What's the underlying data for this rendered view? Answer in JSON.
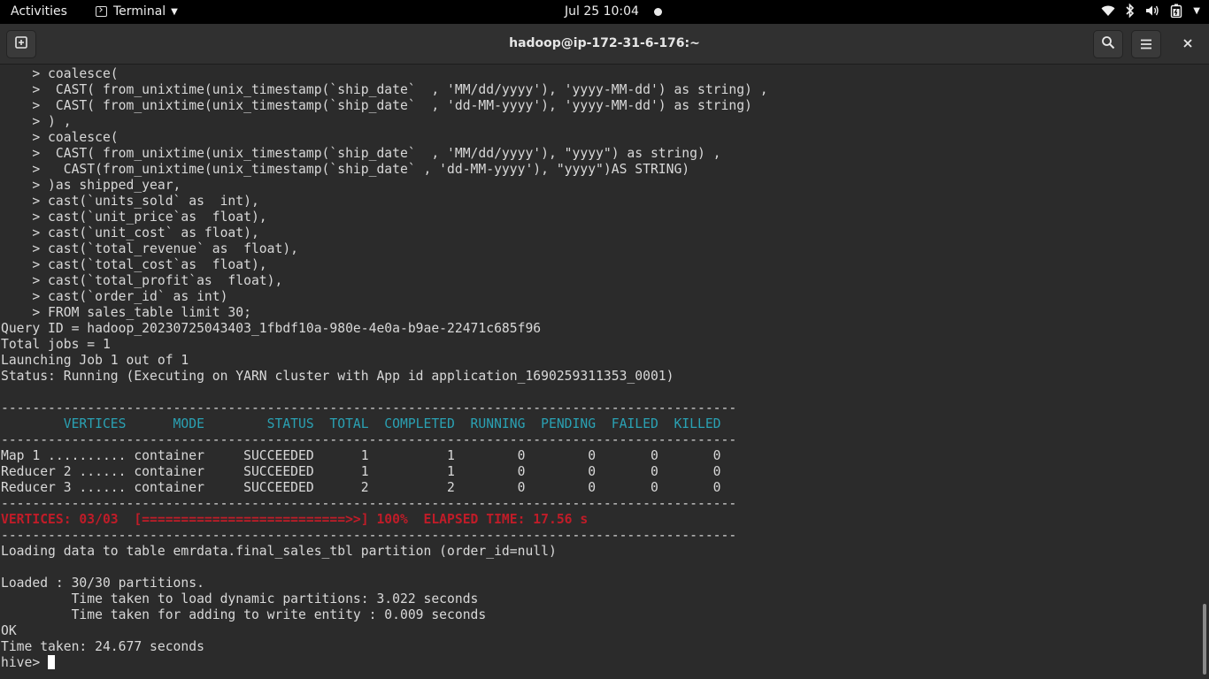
{
  "topbar": {
    "activities": "Activities",
    "app_name": "Terminal",
    "clock": "Jul 25  10:04",
    "icons": [
      "terminal-icon",
      "wifi-icon",
      "bluetooth-icon",
      "volume-icon",
      "battery-icon",
      "chevron-down-icon"
    ]
  },
  "window": {
    "title": "hadoop@ip-172-31-6-176:~",
    "icons": [
      "new-tab-icon",
      "search-icon",
      "hamburger-menu-icon",
      "close-icon"
    ]
  },
  "terminal": {
    "lines": [
      "    > coalesce(",
      "    >  CAST( from_unixtime(unix_timestamp(`ship_date`  , 'MM/dd/yyyy'), 'yyyy-MM-dd') as string) ,",
      "    >  CAST( from_unixtime(unix_timestamp(`ship_date`  , 'dd-MM-yyyy'), 'yyyy-MM-dd') as string)",
      "    > ) ,",
      "    > coalesce(",
      "    >  CAST( from_unixtime(unix_timestamp(`ship_date`  , 'MM/dd/yyyy'), \"yyyy\") as string) ,",
      "    >   CAST(from_unixtime(unix_timestamp(`ship_date` , 'dd-MM-yyyy'), \"yyyy\")AS STRING)",
      "    > )as shipped_year,",
      "    > cast(`units_sold` as  int),",
      "    > cast(`unit_price`as  float),",
      "    > cast(`unit_cost` as float),",
      "    > cast(`total_revenue` as  float),",
      "    > cast(`total_cost`as  float),",
      "    > cast(`total_profit`as  float),",
      "    > cast(`order_id` as int)",
      "    > FROM sales_table limit 30;",
      "Query ID = hadoop_20230725043403_1fbdf10a-980e-4e0a-b9ae-22471c685f96",
      "Total jobs = 1",
      "Launching Job 1 out of 1",
      "Status: Running (Executing on YARN cluster with App id application_1690259311353_0001)",
      "",
      "----------------------------------------------------------------------------------------------",
      "        VERTICES      MODE        STATUS  TOTAL  COMPLETED  RUNNING  PENDING  FAILED  KILLED",
      "----------------------------------------------------------------------------------------------",
      "Map 1 .......... container     SUCCEEDED      1          1        0        0       0       0",
      "Reducer 2 ...... container     SUCCEEDED      1          1        0        0       0       0",
      "Reducer 3 ...... container     SUCCEEDED      2          2        0        0       0       0",
      "----------------------------------------------------------------------------------------------",
      "VERTICES: 03/03  [==========================>>] 100%  ELAPSED TIME: 17.56 s",
      "----------------------------------------------------------------------------------------------",
      "Loading data to table emrdata.final_sales_tbl partition (order_id=null)",
      "",
      "Loaded : 30/30 partitions.",
      "         Time taken to load dynamic partitions: 3.022 seconds",
      "         Time taken for adding to write entity : 0.009 seconds",
      "OK",
      "Time taken: 24.677 seconds"
    ],
    "prompt": "hive> "
  }
}
